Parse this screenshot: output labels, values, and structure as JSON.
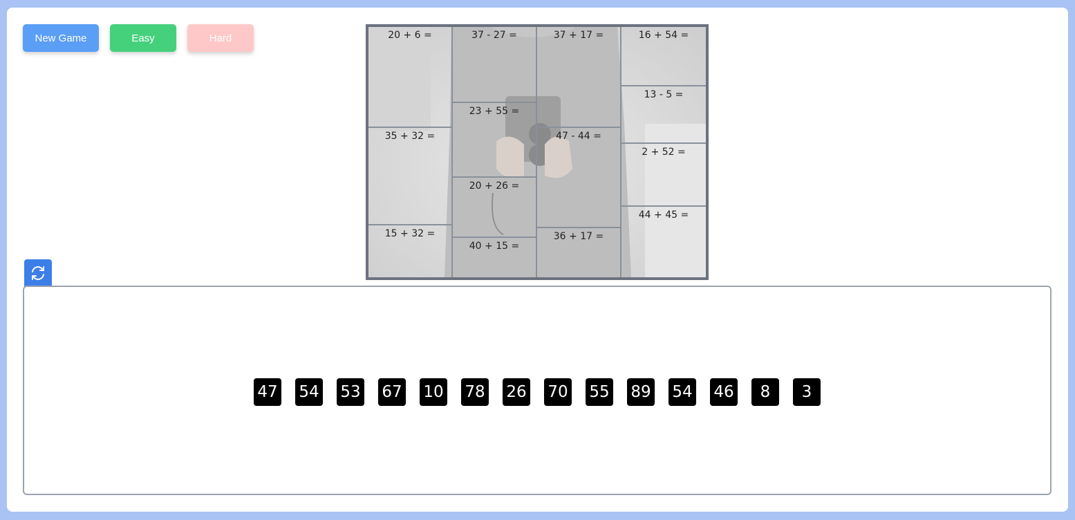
{
  "toolbar": {
    "new_game_label": "New Game",
    "easy_label": "Easy",
    "hard_label": "Hard"
  },
  "puzzle": {
    "columns": [
      [
        "20 + 6 =",
        "35 + 32 =",
        "15 + 32 ="
      ],
      [
        "37 - 27 =",
        "23 + 55 =",
        "20 + 26 =",
        "40 + 15 ="
      ],
      [
        "37 + 17 =",
        "47 - 44 =",
        "36 + 17 ="
      ],
      [
        "16 + 54 =",
        "13 - 5 =",
        "2 + 52 =",
        "44 + 45 ="
      ]
    ]
  },
  "answers": {
    "refresh_icon": "refresh-icon",
    "tiles": [
      "47",
      "54",
      "53",
      "67",
      "10",
      "78",
      "26",
      "70",
      "55",
      "89",
      "54",
      "46",
      "8",
      "3"
    ]
  },
  "colors": {
    "new_game": "#5a9ef5",
    "easy": "#45d17c",
    "hard": "#ffc8c8",
    "refresh_tab": "#3d7fe8",
    "background": "#a9c3f5"
  }
}
